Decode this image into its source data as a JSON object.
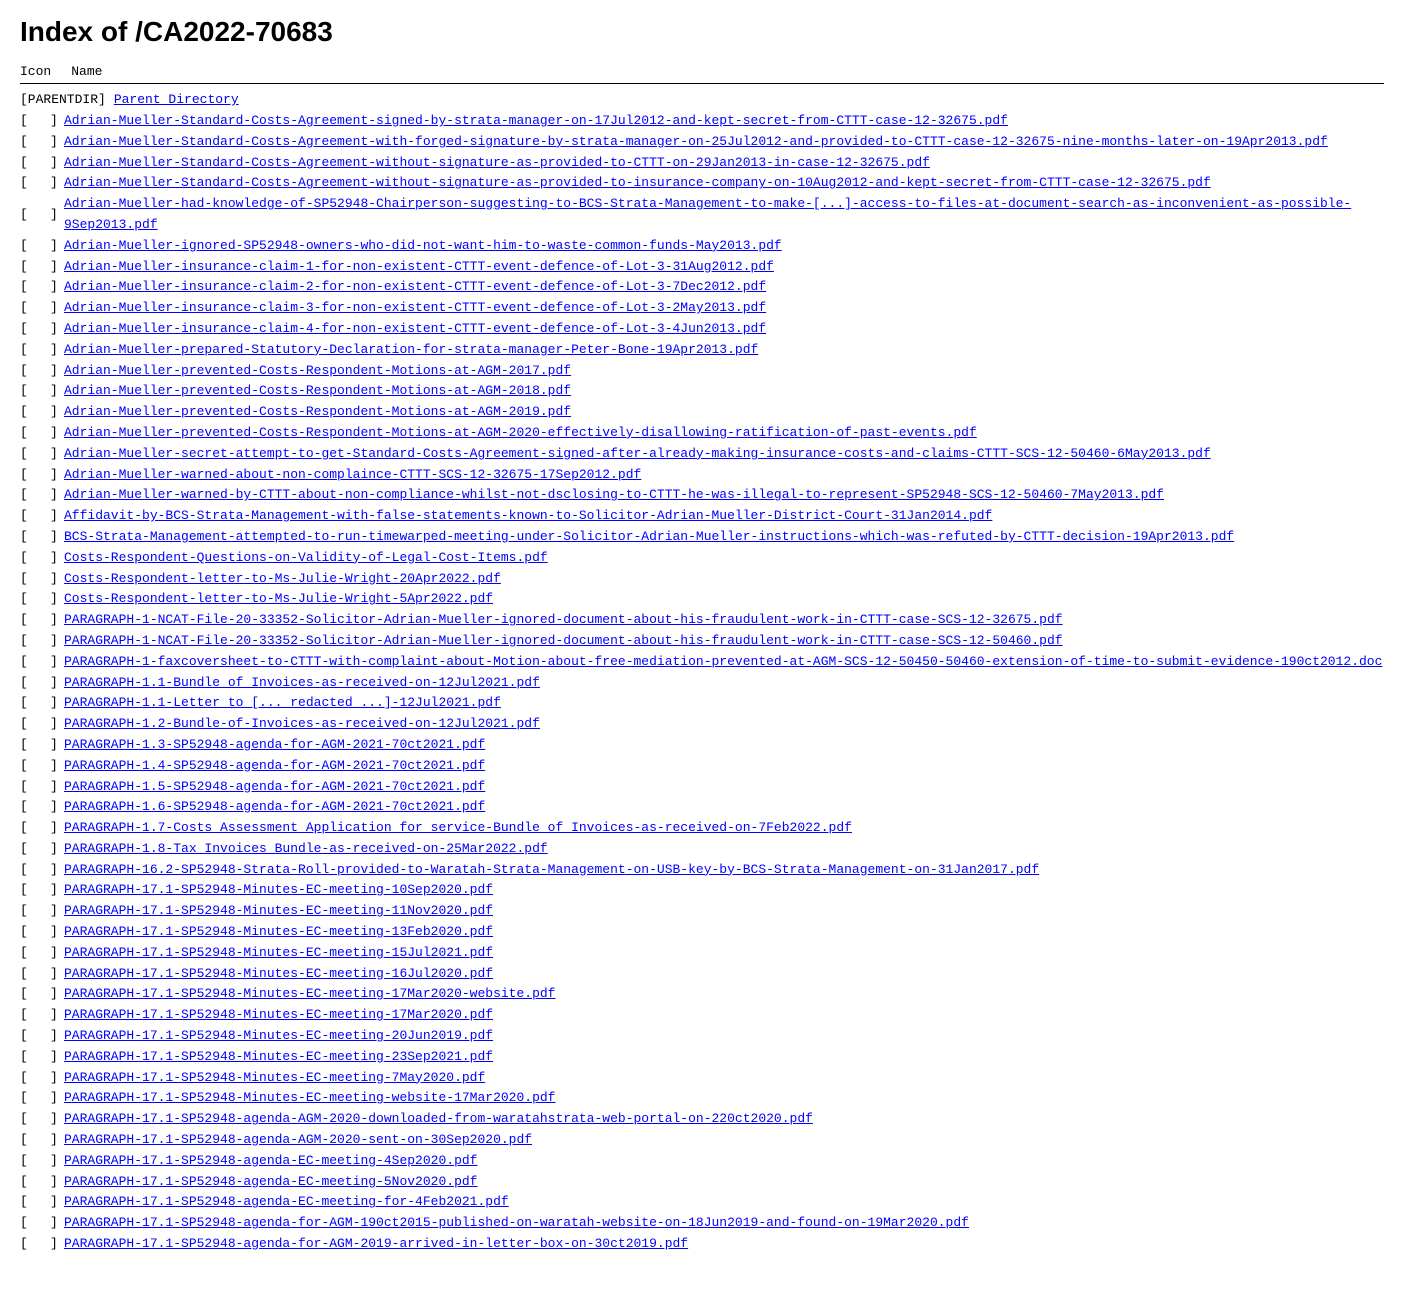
{
  "title": "Index of /CA2022-70683",
  "header": {
    "col1": "Icon",
    "col2": "Name"
  },
  "parentDir": {
    "label": "[PARENTDIR]",
    "linkText": "Parent Directory",
    "href": "/"
  },
  "files": [
    {
      "icon": "[",
      "close": "]",
      "name": "Adrian-Mueller-Standard-Costs-Agreement-signed-by-strata-manager-on-17Jul2012-and-kept-secret-from-CTTT-case-12-32675.pdf"
    },
    {
      "icon": "[",
      "close": "]",
      "name": "Adrian-Mueller-Standard-Costs-Agreement-with-forged-signature-by-strata-manager-on-25Jul2012-and-provided-to-CTTT-case-12-32675-nine-months-later-on-19Apr2013.pdf"
    },
    {
      "icon": "[",
      "close": "]",
      "name": "Adrian-Mueller-Standard-Costs-Agreement-without-signature-as-provided-to-CTTT-on-29Jan2013-in-case-12-32675.pdf"
    },
    {
      "icon": "[",
      "close": "]",
      "name": "Adrian-Mueller-Standard-Costs-Agreement-without-signature-as-provided-to-insurance-company-on-10Aug2012-and-kept-secret-from-CTTT-case-12-32675.pdf"
    },
    {
      "icon": "[",
      "close": "]",
      "name": "Adrian-Mueller-had-knowledge-of-SP52948-Chairperson-suggesting-to-BCS-Strata-Management-to-make-[...]-access-to-files-at-document-search-as-inconvenient-as-possible-9Sep2013.pdf"
    },
    {
      "icon": "[",
      "close": "]",
      "name": "Adrian-Mueller-ignored-SP52948-owners-who-did-not-want-him-to-waste-common-funds-May2013.pdf"
    },
    {
      "icon": "[",
      "close": "]",
      "name": "Adrian-Mueller-insurance-claim-1-for-non-existent-CTTT-event-defence-of-Lot-3-31Aug2012.pdf"
    },
    {
      "icon": "[",
      "close": "]",
      "name": "Adrian-Mueller-insurance-claim-2-for-non-existent-CTTT-event-defence-of-Lot-3-7Dec2012.pdf"
    },
    {
      "icon": "[",
      "close": "]",
      "name": "Adrian-Mueller-insurance-claim-3-for-non-existent-CTTT-event-defence-of-Lot-3-2May2013.pdf"
    },
    {
      "icon": "[",
      "close": "]",
      "name": "Adrian-Mueller-insurance-claim-4-for-non-existent-CTTT-event-defence-of-Lot-3-4Jun2013.pdf"
    },
    {
      "icon": "[",
      "close": "]",
      "name": "Adrian-Mueller-prepared-Statutory-Declaration-for-strata-manager-Peter-Bone-19Apr2013.pdf"
    },
    {
      "icon": "[",
      "close": "]",
      "name": "Adrian-Mueller-prevented-Costs-Respondent-Motions-at-AGM-2017.pdf"
    },
    {
      "icon": "[",
      "close": "]",
      "name": "Adrian-Mueller-prevented-Costs-Respondent-Motions-at-AGM-2018.pdf"
    },
    {
      "icon": "[",
      "close": "]",
      "name": "Adrian-Mueller-prevented-Costs-Respondent-Motions-at-AGM-2019.pdf"
    },
    {
      "icon": "[",
      "close": "]",
      "name": "Adrian-Mueller-prevented-Costs-Respondent-Motions-at-AGM-2020-effectively-disallowing-ratification-of-past-events.pdf"
    },
    {
      "icon": "[",
      "close": "]",
      "name": "Adrian-Mueller-secret-attempt-to-get-Standard-Costs-Agreement-signed-after-already-making-insurance-costs-and-claims-CTTT-SCS-12-50460-6May2013.pdf"
    },
    {
      "icon": "[",
      "close": "]",
      "name": "Adrian-Mueller-warned-about-non-complaince-CTTT-SCS-12-32675-17Sep2012.pdf"
    },
    {
      "icon": "[",
      "close": "]",
      "name": "Adrian-Mueller-warned-by-CTTT-about-non-compliance-whilst-not-dsclosing-to-CTTT-he-was-illegal-to-represent-SP52948-SCS-12-50460-7May2013.pdf"
    },
    {
      "icon": "[",
      "close": "]",
      "name": "Affidavit-by-BCS-Strata-Management-with-false-statements-known-to-Solicitor-Adrian-Mueller-District-Court-31Jan2014.pdf"
    },
    {
      "icon": "[",
      "close": "]",
      "name": "BCS-Strata-Management-attempted-to-run-timewarped-meeting-under-Solicitor-Adrian-Mueller-instructions-which-was-refuted-by-CTTT-decision-19Apr2013.pdf"
    },
    {
      "icon": "[",
      "close": "]",
      "name": "Costs-Respondent-Questions-on-Validity-of-Legal-Cost-Items.pdf"
    },
    {
      "icon": "[",
      "close": "]",
      "name": "Costs-Respondent-letter-to-Ms-Julie-Wright-20Apr2022.pdf"
    },
    {
      "icon": "[",
      "close": "]",
      "name": "Costs-Respondent-letter-to-Ms-Julie-Wright-5Apr2022.pdf"
    },
    {
      "icon": "[",
      "close": "]",
      "name": "PARAGRAPH-1-NCAT-File-20-33352-Solicitor-Adrian-Mueller-ignored-document-about-his-fraudulent-work-in-CTTT-case-SCS-12-32675.pdf"
    },
    {
      "icon": "[",
      "close": "]",
      "name": "PARAGRAPH-1-NCAT-File-20-33352-Solicitor-Adrian-Mueller-ignored-document-about-his-fraudulent-work-in-CTTT-case-SCS-12-50460.pdf"
    },
    {
      "icon": "[",
      "close": "]",
      "name": "PARAGRAPH-1-faxcoversheet-to-CTTT-with-complaint-about-Motion-about-free-mediation-prevented-at-AGM-SCS-12-50450-50460-extension-of-time-to-submit-evidence-190ct2012.doc"
    },
    {
      "icon": "[",
      "close": "]",
      "name": "PARAGRAPH-1.1-Bundle of Invoices-as-received-on-12Jul2021.pdf"
    },
    {
      "icon": "[",
      "close": "]",
      "name": "PARAGRAPH-1.1-Letter to [... redacted ...]-12Jul2021.pdf"
    },
    {
      "icon": "[",
      "close": "]",
      "name": "PARAGRAPH-1.2-Bundle-of-Invoices-as-received-on-12Jul2021.pdf"
    },
    {
      "icon": "[",
      "close": "]",
      "name": "PARAGRAPH-1.3-SP52948-agenda-for-AGM-2021-70ct2021.pdf"
    },
    {
      "icon": "[",
      "close": "]",
      "name": "PARAGRAPH-1.4-SP52948-agenda-for-AGM-2021-70ct2021.pdf"
    },
    {
      "icon": "[",
      "close": "]",
      "name": "PARAGRAPH-1.5-SP52948-agenda-for-AGM-2021-70ct2021.pdf"
    },
    {
      "icon": "[",
      "close": "]",
      "name": "PARAGRAPH-1.6-SP52948-agenda-for-AGM-2021-70ct2021.pdf"
    },
    {
      "icon": "[",
      "close": "]",
      "name": "PARAGRAPH-1.7-Costs Assessment Application for service-Bundle of Invoices-as-received-on-7Feb2022.pdf"
    },
    {
      "icon": "[",
      "close": "]",
      "name": "PARAGRAPH-1.8-Tax Invoices Bundle-as-received-on-25Mar2022.pdf"
    },
    {
      "icon": "[",
      "close": "]",
      "name": "PARAGRAPH-16.2-SP52948-Strata-Roll-provided-to-Waratah-Strata-Management-on-USB-key-by-BCS-Strata-Management-on-31Jan2017.pdf"
    },
    {
      "icon": "[",
      "close": "]",
      "name": "PARAGRAPH-17.1-SP52948-Minutes-EC-meeting-10Sep2020.pdf"
    },
    {
      "icon": "[",
      "close": "]",
      "name": "PARAGRAPH-17.1-SP52948-Minutes-EC-meeting-11Nov2020.pdf"
    },
    {
      "icon": "[",
      "close": "]",
      "name": "PARAGRAPH-17.1-SP52948-Minutes-EC-meeting-13Feb2020.pdf"
    },
    {
      "icon": "[",
      "close": "]",
      "name": "PARAGRAPH-17.1-SP52948-Minutes-EC-meeting-15Jul2021.pdf"
    },
    {
      "icon": "[",
      "close": "]",
      "name": "PARAGRAPH-17.1-SP52948-Minutes-EC-meeting-16Jul2020.pdf"
    },
    {
      "icon": "[",
      "close": "]",
      "name": "PARAGRAPH-17.1-SP52948-Minutes-EC-meeting-17Mar2020-website.pdf"
    },
    {
      "icon": "[",
      "close": "]",
      "name": "PARAGRAPH-17.1-SP52948-Minutes-EC-meeting-17Mar2020.pdf"
    },
    {
      "icon": "[",
      "close": "]",
      "name": "PARAGRAPH-17.1-SP52948-Minutes-EC-meeting-20Jun2019.pdf"
    },
    {
      "icon": "[",
      "close": "]",
      "name": "PARAGRAPH-17.1-SP52948-Minutes-EC-meeting-23Sep2021.pdf"
    },
    {
      "icon": "[",
      "close": "]",
      "name": "PARAGRAPH-17.1-SP52948-Minutes-EC-meeting-7May2020.pdf"
    },
    {
      "icon": "[",
      "close": "]",
      "name": "PARAGRAPH-17.1-SP52948-Minutes-EC-meeting-website-17Mar2020.pdf"
    },
    {
      "icon": "[",
      "close": "]",
      "name": "PARAGRAPH-17.1-SP52948-agenda-AGM-2020-downloaded-from-waratahstrata-web-portal-on-220ct2020.pdf"
    },
    {
      "icon": "[",
      "close": "]",
      "name": "PARAGRAPH-17.1-SP52948-agenda-AGM-2020-sent-on-30Sep2020.pdf"
    },
    {
      "icon": "[",
      "close": "]",
      "name": "PARAGRAPH-17.1-SP52948-agenda-EC-meeting-4Sep2020.pdf"
    },
    {
      "icon": "[",
      "close": "]",
      "name": "PARAGRAPH-17.1-SP52948-agenda-EC-meeting-5Nov2020.pdf"
    },
    {
      "icon": "[",
      "close": "]",
      "name": "PARAGRAPH-17.1-SP52948-agenda-EC-meeting-for-4Feb2021.pdf"
    },
    {
      "icon": "[",
      "close": "]",
      "name": "PARAGRAPH-17.1-SP52948-agenda-for-AGM-190ct2015-published-on-waratah-website-on-18Jun2019-and-found-on-19Mar2020.pdf"
    },
    {
      "icon": "[",
      "close": "]",
      "name": "PARAGRAPH-17.1-SP52948-agenda-for-AGM-2019-arrived-in-letter-box-on-30ct2019.pdf"
    }
  ]
}
